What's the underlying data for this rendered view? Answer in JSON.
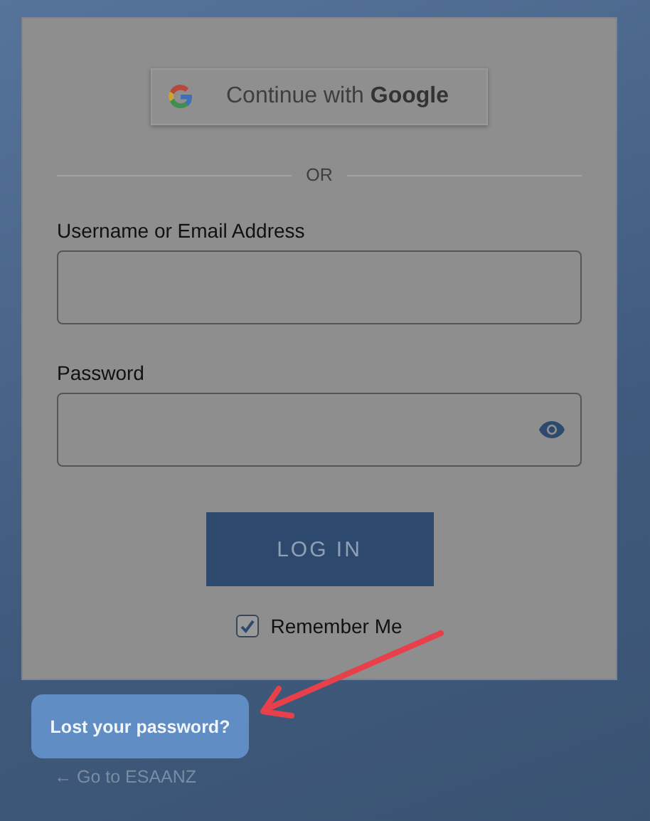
{
  "google_button": {
    "label": "Continue with **Google**"
  },
  "divider": {
    "label": "OR"
  },
  "fields": [
    {
      "label": "Username or Email Address",
      "kind": "text"
    },
    {
      "label": "Password",
      "kind": "password"
    }
  ],
  "login_button": {
    "label": "LOG IN"
  },
  "remember": {
    "label": "Remember Me",
    "checked": true
  },
  "lost_password": {
    "label": "Lost your password?"
  },
  "back_link": {
    "label": "← Go to ESAANZ"
  },
  "annotation": {
    "kind": "arrow"
  }
}
